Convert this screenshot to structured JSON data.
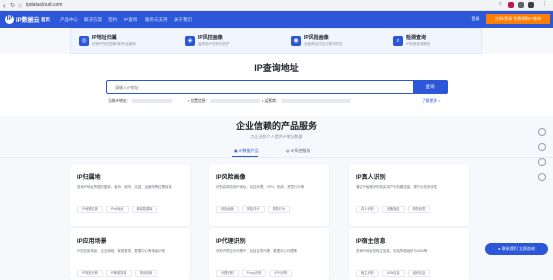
{
  "browser": {
    "url": "ipdatacloud.com"
  },
  "brand": {
    "logo_text": "IP数据云",
    "logo_mark": "IP",
    "accent": "#2c57d9",
    "cta_color": "#ff7d00"
  },
  "topnav": {
    "items": [
      {
        "label": "首页"
      },
      {
        "label": "产品中心"
      },
      {
        "label": "解决方案"
      },
      {
        "label": "签约"
      },
      {
        "label": "IP查询"
      },
      {
        "label": "服务与支持"
      },
      {
        "label": "关于我们"
      }
    ],
    "login_label": "登录",
    "console_label": "注册/登录 免费领取IP查询"
  },
  "menu": {
    "items": [
      {
        "title": "IP地址归属",
        "subtitle": "识别IP所在国家/城市/运营商"
      },
      {
        "title": "IP风控画像",
        "subtitle": "高风险IP识别与防护"
      },
      {
        "title": "IP风险画像",
        "subtitle": "全面风险评估与欺诈防控"
      },
      {
        "title": "检测查询",
        "subtitle": "IP检测查询服务"
      }
    ]
  },
  "hero": {
    "title": "IP查询地址",
    "search_placeholder": "请输入IP地址",
    "search_button": "查询",
    "info": [
      {
        "label": "当前IP地址："
      },
      {
        "label": "• 位置信息："
      },
      {
        "label": "• 运营商："
      }
    ],
    "more_link": "了解更多 >"
  },
  "products": {
    "title": "企业信赖的产品服务",
    "subtitle": "为企业和个人提供IP地址数据",
    "tabs": [
      {
        "label": "IP数据产品"
      },
      {
        "label": "IP风控服务"
      }
    ],
    "cards": [
      {
        "title": "IP归属地",
        "desc": "查询IP地址所属的国家、省份、城市、区县、运营商等位置信息",
        "tags": [
          "IP地理位置",
          "IPv6地址",
          "离线数据库"
        ]
      },
      {
        "title": "IP风险画像",
        "desc": "识别高风险的IP地址，包括代理、VPN、机房、恶意行为等",
        "tags": [
          "风险画像",
          "风险评分",
          "风险行为"
        ]
      },
      {
        "title": "IP真人识别",
        "desc": "通过IP画像识别真实用户与机器流量，提升业务安全性",
        "tags": [
          "真人识别",
          "设备指纹",
          "风险标签"
        ]
      },
      {
        "title": "IP应用场景",
        "desc": "IP的应用场景、企业网络、家庭宽带、数据中心等场景识别",
        "tags": [
          "IP场景识别",
          "IP使用场景",
          "场景判断"
        ]
      },
      {
        "title": "IP代理识别",
        "desc": "识别IP是否为代理IP，包括住宅代理、数据中心代理等",
        "tags": [
          "代理识别",
          "Proxy识别",
          "VPN识别"
        ]
      },
      {
        "title": "IP宿主信息",
        "desc": "查询IP地址的宿主信息，包括所属组织与ASN等",
        "tags": [
          "宿主识别",
          "ASN信息",
          "组织信息"
        ]
      }
    ]
  },
  "float_button": {
    "label": "联系我们 立即咨询"
  }
}
